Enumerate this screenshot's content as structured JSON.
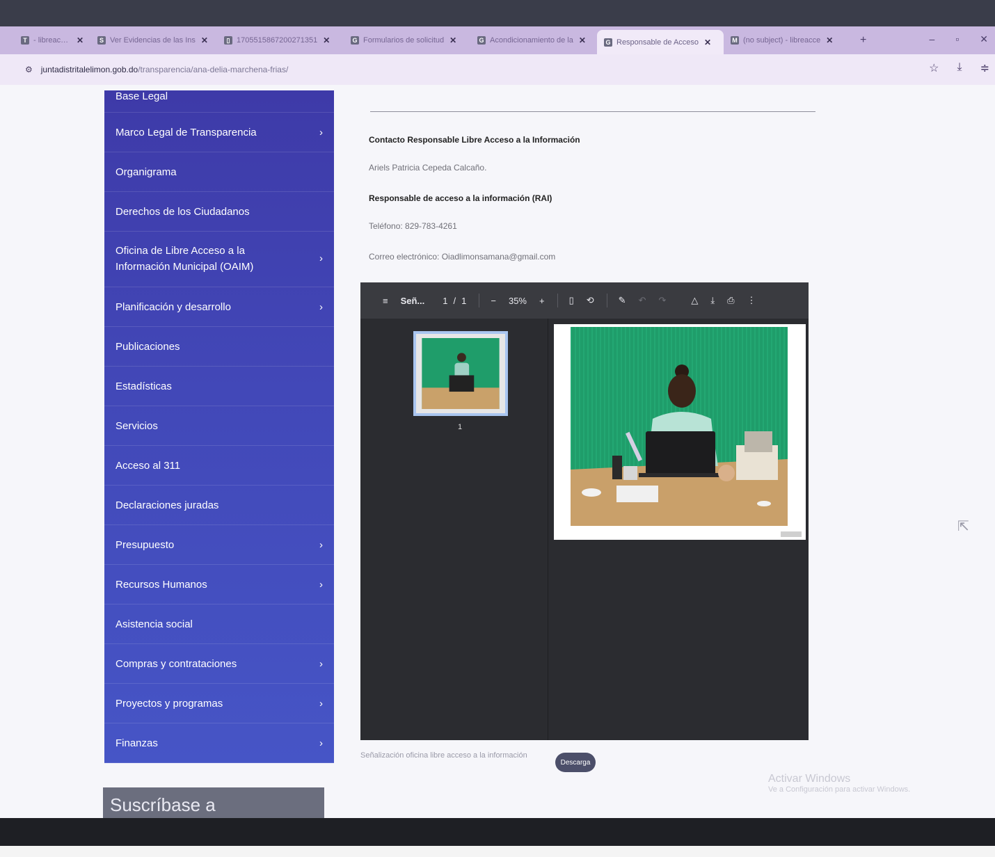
{
  "browser": {
    "tabs": [
      {
        "title": "- libreaccesoi:",
        "favicon": "T",
        "active": false
      },
      {
        "title": "Ver Evidencias de las Ins",
        "favicon": "S",
        "active": false
      },
      {
        "title": "1705515867200271351",
        "favicon": "▯",
        "active": false
      },
      {
        "title": "Formularios de solicitud",
        "favicon": "G",
        "active": false
      },
      {
        "title": "Acondicionamiento de la",
        "favicon": "G",
        "active": false
      },
      {
        "title": "Responsable de Acceso",
        "favicon": "G",
        "active": true
      },
      {
        "title": "(no subject) - libreacce",
        "favicon": "M",
        "active": false
      }
    ],
    "new_tab": "+",
    "url_host": "juntadistritalelimon.gob.do",
    "url_path": "/transparencia/ana-delia-marchena-frias/"
  },
  "sidebar": {
    "items": [
      {
        "label": "Base Legal",
        "has_sub": false
      },
      {
        "label": "Marco Legal de Transparencia",
        "has_sub": true
      },
      {
        "label": "Organigrama",
        "has_sub": false
      },
      {
        "label": "Derechos de los Ciudadanos",
        "has_sub": false
      },
      {
        "label": "Oficina de Libre Acceso a la Información Municipal (OAIM)",
        "has_sub": true
      },
      {
        "label": "Planificación y desarrollo",
        "has_sub": true
      },
      {
        "label": "Publicaciones",
        "has_sub": false
      },
      {
        "label": "Estadísticas",
        "has_sub": false
      },
      {
        "label": "Servicios",
        "has_sub": false
      },
      {
        "label": "Acceso al 311",
        "has_sub": false
      },
      {
        "label": "Declaraciones juradas",
        "has_sub": false
      },
      {
        "label": "Presupuesto",
        "has_sub": true
      },
      {
        "label": "Recursos Humanos",
        "has_sub": true
      },
      {
        "label": "Asistencia social",
        "has_sub": false
      },
      {
        "label": "Compras y contrataciones",
        "has_sub": true
      },
      {
        "label": "Proyectos y programas",
        "has_sub": true
      },
      {
        "label": "Finanzas",
        "has_sub": true
      }
    ],
    "subscribe_label": "Suscríbase a"
  },
  "main": {
    "contact_heading": "Contacto Responsable Libre Acceso a la Información",
    "contact_name": "Ariels Patricia Cepeda Calcaño.",
    "rai_heading": "Responsable de acceso a la información (RAI)",
    "phone": "Teléfono: 829-783-4261",
    "email": "Correo electrónico: Oiadlimonsamana@gmail.com",
    "pdf": {
      "title": "Señ...",
      "page_current": "1",
      "page_sep": "/",
      "page_total": "1",
      "zoom_minus": "−",
      "zoom": "35%",
      "zoom_plus": "+",
      "thumb_number": "1"
    },
    "bottom_link": "Señalización oficina libre acceso a la información",
    "download_label": "Descarga"
  },
  "os": {
    "activate_title": "Activar Windows",
    "activate_sub": "Ve a Configuración para activar Windows."
  },
  "colors": {
    "sidebar": "#4248b8",
    "tab_strip": "#c9b8e0",
    "pdf_bg": "#2b2c30",
    "photo_wall": "#1f9d6a"
  }
}
